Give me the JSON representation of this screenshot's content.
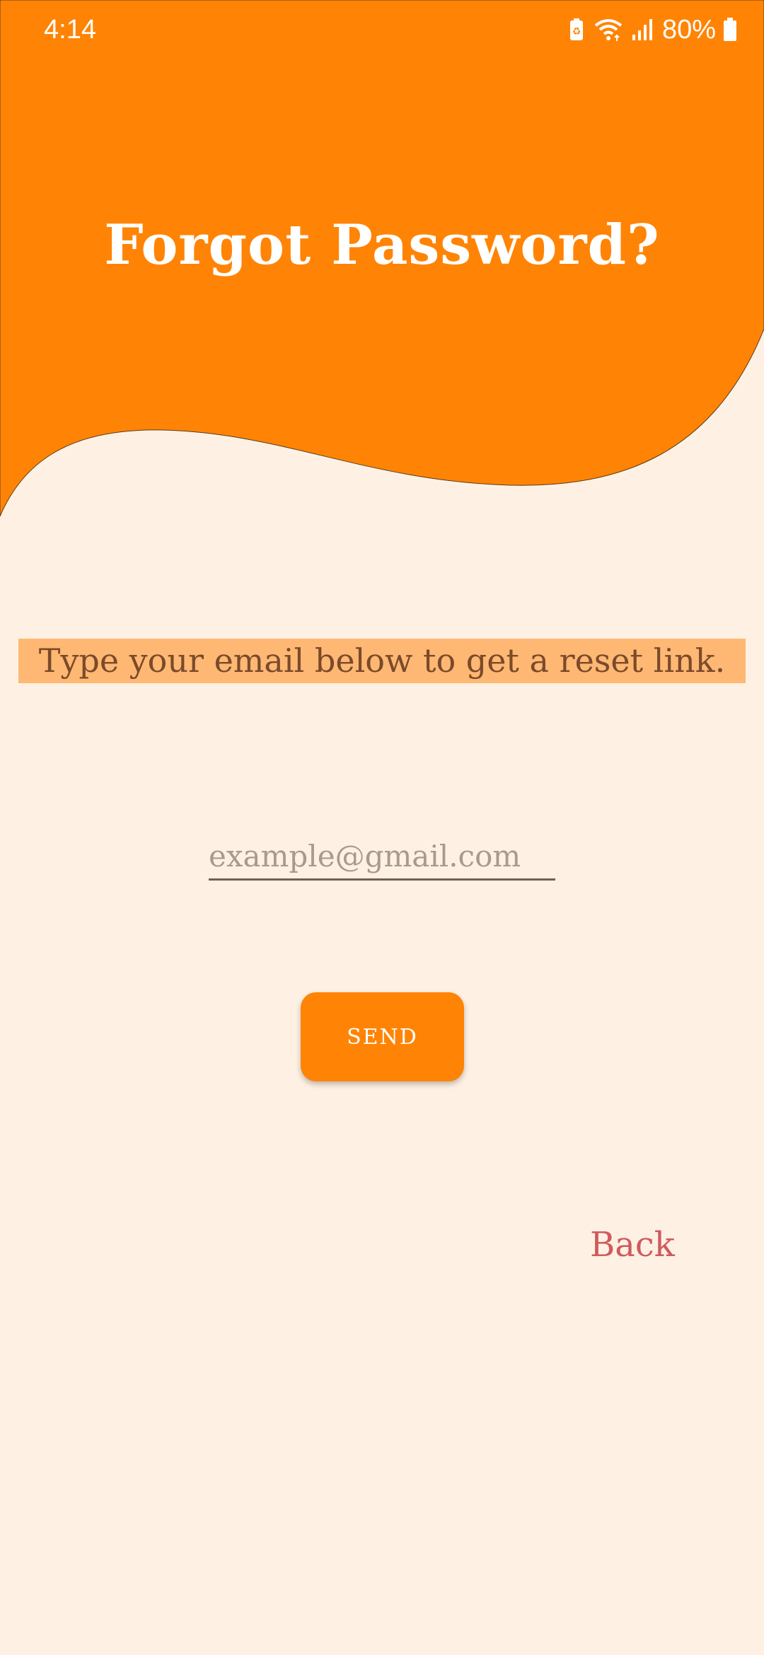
{
  "status_bar": {
    "time": "4:14",
    "battery": "80%",
    "icons": [
      "battery-saver-icon",
      "wifi-icon",
      "signal-icon",
      "battery-icon"
    ]
  },
  "header": {
    "title": "Forgot Password?"
  },
  "form": {
    "instruction": "Type your email below to get a reset link.",
    "email_placeholder": "example@gmail.com",
    "email_value": "",
    "send_label": "SEND",
    "back_label": "Back"
  },
  "colors": {
    "accent": "#FF8405",
    "background": "#FEF1E3",
    "highlight": "#FFB873",
    "instruction_text": "#7A4A2A",
    "back_link": "#D05A5E"
  }
}
